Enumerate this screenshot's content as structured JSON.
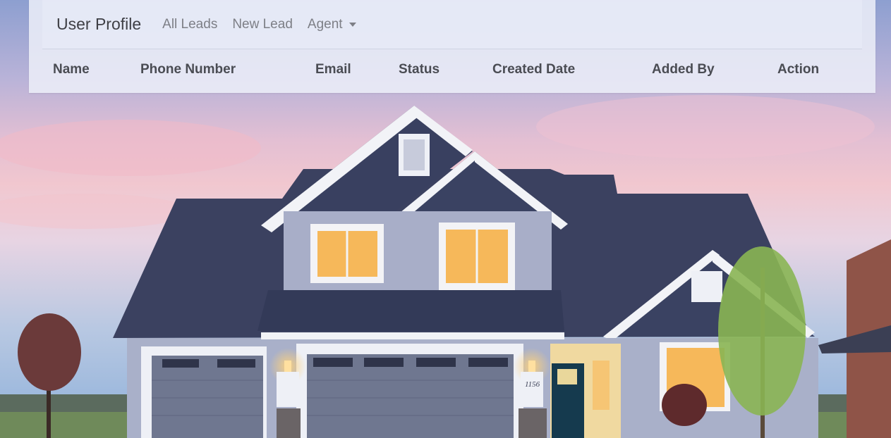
{
  "navbar": {
    "brand": "User Profile",
    "links": [
      {
        "label": "All Leads"
      },
      {
        "label": "New Lead"
      },
      {
        "label": "Agent",
        "dropdown": true
      }
    ]
  },
  "table": {
    "columns": [
      "Name",
      "Phone Number",
      "Email",
      "Status",
      "Created Date",
      "Added By",
      "Action"
    ]
  },
  "background": {
    "house_number": "1156"
  }
}
